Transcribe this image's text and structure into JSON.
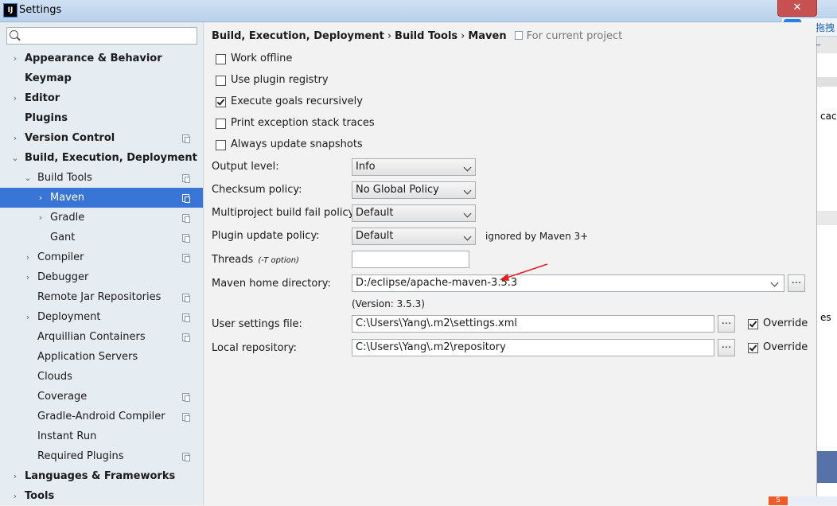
{
  "window": {
    "title": "Settings",
    "app_icon_text": "IJ",
    "close_glyph": "✕"
  },
  "cloud_widget": {
    "label": "拖拽_"
  },
  "background_app": {
    "text1": "cach",
    "text2": "es"
  },
  "search": {
    "placeholder": "",
    "value": ""
  },
  "sidebar": {
    "items": [
      {
        "label": "Appearance & Behavior",
        "bold": true,
        "arrow": "›",
        "level": 0,
        "copy": false
      },
      {
        "label": "Keymap",
        "bold": true,
        "arrow": "",
        "level": 0,
        "copy": false
      },
      {
        "label": "Editor",
        "bold": true,
        "arrow": "›",
        "level": 0,
        "copy": false
      },
      {
        "label": "Plugins",
        "bold": true,
        "arrow": "",
        "level": 0,
        "copy": false
      },
      {
        "label": "Version Control",
        "bold": true,
        "arrow": "›",
        "level": 0,
        "copy": true
      },
      {
        "label": "Build, Execution, Deployment",
        "bold": true,
        "arrow": "⌄",
        "level": 0,
        "copy": false
      },
      {
        "label": "Build Tools",
        "bold": false,
        "arrow": "⌄",
        "level": 1,
        "copy": true
      },
      {
        "label": "Maven",
        "bold": false,
        "arrow": "›",
        "level": 2,
        "copy": true,
        "selected": true
      },
      {
        "label": "Gradle",
        "bold": false,
        "arrow": "›",
        "level": 2,
        "copy": true
      },
      {
        "label": "Gant",
        "bold": false,
        "arrow": "",
        "level": 2,
        "copy": true
      },
      {
        "label": "Compiler",
        "bold": false,
        "arrow": "›",
        "level": 1,
        "copy": true
      },
      {
        "label": "Debugger",
        "bold": false,
        "arrow": "›",
        "level": 1,
        "copy": false
      },
      {
        "label": "Remote Jar Repositories",
        "bold": false,
        "arrow": "",
        "level": 1,
        "copy": true
      },
      {
        "label": "Deployment",
        "bold": false,
        "arrow": "›",
        "level": 1,
        "copy": true
      },
      {
        "label": "Arquillian Containers",
        "bold": false,
        "arrow": "",
        "level": 1,
        "copy": true
      },
      {
        "label": "Application Servers",
        "bold": false,
        "arrow": "",
        "level": 1,
        "copy": false
      },
      {
        "label": "Clouds",
        "bold": false,
        "arrow": "",
        "level": 1,
        "copy": false
      },
      {
        "label": "Coverage",
        "bold": false,
        "arrow": "",
        "level": 1,
        "copy": true
      },
      {
        "label": "Gradle-Android Compiler",
        "bold": false,
        "arrow": "",
        "level": 1,
        "copy": true
      },
      {
        "label": "Instant Run",
        "bold": false,
        "arrow": "",
        "level": 1,
        "copy": false
      },
      {
        "label": "Required Plugins",
        "bold": false,
        "arrow": "",
        "level": 1,
        "copy": true
      },
      {
        "label": "Languages & Frameworks",
        "bold": true,
        "arrow": "›",
        "level": 0,
        "copy": false
      },
      {
        "label": "Tools",
        "bold": true,
        "arrow": "›",
        "level": 0,
        "copy": false
      }
    ]
  },
  "breadcrumb": {
    "part1": "Build, Execution, Deployment",
    "sep": "›",
    "part2": "Build Tools",
    "part3": "Maven",
    "scope": "For current project"
  },
  "checkboxes": {
    "work_offline": {
      "label": "Work offline",
      "checked": false
    },
    "use_plugin_registry": {
      "label": "Use plugin registry",
      "checked": false
    },
    "execute_goals": {
      "label": "Execute goals recursively",
      "checked": true
    },
    "print_exception": {
      "label": "Print exception stack traces",
      "checked": false
    },
    "always_update": {
      "label": "Always update snapshots",
      "checked": false
    }
  },
  "form": {
    "output_level": {
      "label": "Output level:",
      "value": "Info"
    },
    "checksum_policy": {
      "label": "Checksum policy:",
      "value": "No Global Policy"
    },
    "multiproject_fail": {
      "label": "Multiproject build fail policy:",
      "value": "Default"
    },
    "plugin_update": {
      "label": "Plugin update policy:",
      "value": "Default",
      "note": "ignored by Maven 3+"
    },
    "threads": {
      "label": "Threads",
      "hint": "(-T option)",
      "value": ""
    },
    "maven_home": {
      "label": "Maven home directory:",
      "value": "D:/eclipse/apache-maven-3.5.3",
      "version": "(Version: 3.5.3)"
    },
    "user_settings": {
      "label": "User settings file:",
      "value": "C:\\Users\\Yang\\.m2\\settings.xml",
      "override_label": "Override",
      "override_checked": true
    },
    "local_repo": {
      "label": "Local repository:",
      "value": "C:\\Users\\Yang\\.m2\\repository",
      "override_label": "Override",
      "override_checked": true
    },
    "browse_label": "..."
  },
  "colors": {
    "selection": "#3875d7",
    "annotation_arrow": "#e02020"
  }
}
